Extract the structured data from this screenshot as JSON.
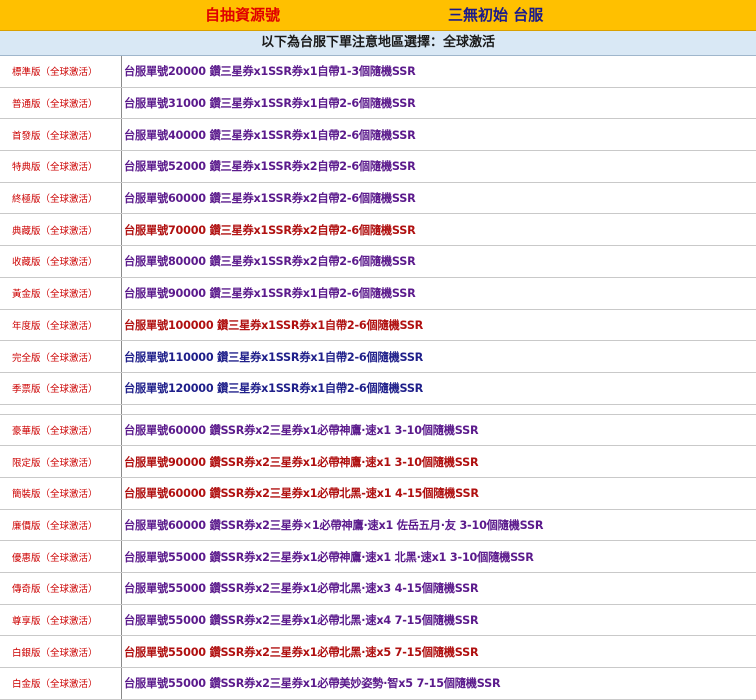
{
  "header": {
    "left_title": "自抽資源號",
    "right_title": "三無初始 台服",
    "subtitle": "以下為台服下單注意地區選擇：全球激活"
  },
  "colors": {
    "header_bg": "#ffc000",
    "subheader_bg": "#d9e8f5",
    "name_red": "#cc0000",
    "desc_purple": "#5b1a8c",
    "desc_red": "#b01010",
    "desc_navy": "#1f1f8a"
  },
  "group1": [
    {
      "name": "標準版（全球激活）",
      "desc": "台服單號20000 鑽三星券x1SSR券x1自帶1-3個隨機SSR",
      "tone": "purple"
    },
    {
      "name": "普通版（全球激活）",
      "desc": "台服單號31000 鑽三星券x1SSR券x1自帶2-6個隨機SSR",
      "tone": "purple"
    },
    {
      "name": "首發版（全球激活）",
      "desc": "台服單號40000 鑽三星券x1SSR券x1自帶2-6個隨機SSR",
      "tone": "purple"
    },
    {
      "name": "特典版（全球激活）",
      "desc": "台服單號52000 鑽三星券x1SSR券x2自帶2-6個隨機SSR",
      "tone": "purple"
    },
    {
      "name": "終極版（全球激活）",
      "desc": "台服單號60000 鑽三星券x1SSR券x2自帶2-6個隨機SSR",
      "tone": "purple"
    },
    {
      "name": "典藏版（全球激活）",
      "desc": "台服單號70000 鑽三星券x1SSR券x2自帶2-6個隨機SSR",
      "tone": "red"
    },
    {
      "name": "收藏版（全球激活）",
      "desc": "台服單號80000 鑽三星券x1SSR券x2自帶2-6個隨機SSR",
      "tone": "purple"
    },
    {
      "name": "黃金版（全球激活）",
      "desc": "台服單號90000 鑽三星券x1SSR券x1自帶2-6個隨機SSR",
      "tone": "purple"
    },
    {
      "name": "年度版（全球激活）",
      "desc": "台服單號100000 鑽三星券x1SSR券x1自帶2-6個隨機SSR",
      "tone": "red"
    },
    {
      "name": "完全版（全球激活）",
      "desc": "台服單號110000 鑽三星券x1SSR券x1自帶2-6個隨機SSR",
      "tone": "navy"
    },
    {
      "name": "季票版（全球激活）",
      "desc": "台服單號120000 鑽三星券x1SSR券x1自帶2-6個隨機SSR",
      "tone": "navy"
    }
  ],
  "group2": [
    {
      "name": "豪華版（全球激活）",
      "desc": "台服單號60000 鑽SSR券x2三星券x1必帶神鷹·速x1 3-10個隨機SSR",
      "tone": "purple"
    },
    {
      "name": "限定版（全球激活）",
      "desc": "台服單號90000 鑽SSR券x2三星券x1必帶神鷹·速x1 3-10個隨機SSR",
      "tone": "red"
    },
    {
      "name": "簡裝版（全球激活）",
      "desc": "台服單號60000 鑽SSR券x2三星券x1必帶北黑-速x1 4-15個隨機SSR",
      "tone": "red"
    },
    {
      "name": "廉價版（全球激活）",
      "desc": "台服單號60000 鑽SSR券x2三星券×1必帶神鷹·速x1 佐岳五月·友 3-10個隨機SSR",
      "tone": "purple"
    },
    {
      "name": "優惠版（全球激活）",
      "desc": "台服單號55000 鑽SSR券x2三星券x1必帶神鷹·速x1 北黑·速x1 3-10個隨機SSR",
      "tone": "purple"
    },
    {
      "name": "傳奇版（全球激活）",
      "desc": "台服單號55000 鑽SSR券x2三星券x1必帶北黑·速x3 4-15個隨機SSR",
      "tone": "purple"
    },
    {
      "name": "尊享版（全球激活）",
      "desc": "台服單號55000 鑽SSR券x2三星券x1必帶北黑·速x4 7-15個隨機SSR",
      "tone": "purple"
    },
    {
      "name": "白銀版（全球激活）",
      "desc": "台服單號55000 鑽SSR券x2三星券x1必帶北黑·速x5 7-15個隨機SSR",
      "tone": "red"
    },
    {
      "name": "白金版（全球激活）",
      "desc": "台服單號55000 鑽SSR券x2三星券x1必帶美妙姿勢·智x5 7-15個隨機SSR",
      "tone": "purple"
    }
  ]
}
